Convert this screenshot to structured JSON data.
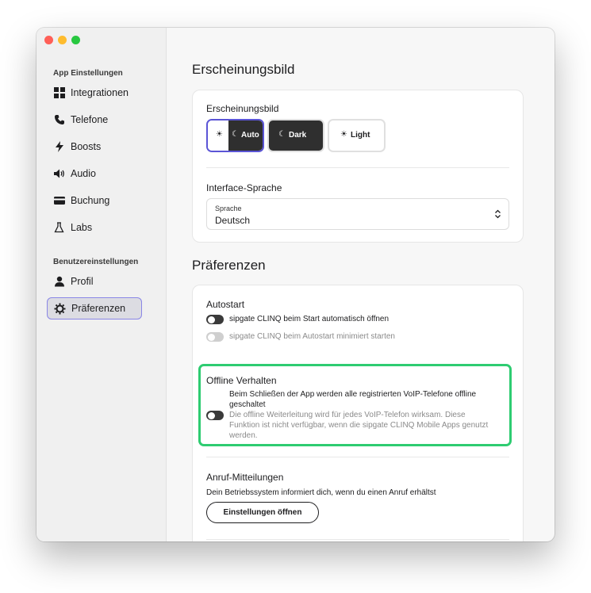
{
  "sidebar": {
    "section_app": "App Einstellungen",
    "section_user": "Benutzereinstellungen",
    "items": [
      {
        "label": "Integrationen",
        "icon": "grid-icon"
      },
      {
        "label": "Telefone",
        "icon": "phone-icon"
      },
      {
        "label": "Boosts",
        "icon": "bolt-icon"
      },
      {
        "label": "Audio",
        "icon": "speaker-icon"
      },
      {
        "label": "Buchung",
        "icon": "credit-card-icon"
      },
      {
        "label": "Labs",
        "icon": "flask-icon"
      },
      {
        "label": "Profil",
        "icon": "user-icon"
      },
      {
        "label": "Präferenzen",
        "icon": "gear-icon",
        "active": true
      }
    ]
  },
  "appearance": {
    "heading": "Erscheinungsbild",
    "label": "Erscheinungsbild",
    "options": [
      {
        "label": "Auto",
        "selected": true
      },
      {
        "label": "Dark"
      },
      {
        "label": "Light"
      }
    ],
    "language_label": "Interface-Sprache",
    "select_caption": "Sprache",
    "select_value": "Deutsch"
  },
  "preferences": {
    "heading": "Präferenzen",
    "autostart_label": "Autostart",
    "autostart_open": "sipgate CLINQ beim Start automatisch öffnen",
    "autostart_minimized": "sipgate CLINQ beim Autostart minimiert starten",
    "offline_label": "Offline Verhalten",
    "offline_line1": "Beim Schließen der App werden alle registrierten VoIP-Telefone offline",
    "offline_line2": "geschaltet",
    "offline_desc1": "Die offline Weiterleitung wird für jedes VoIP-Telefon wirksam. Diese",
    "offline_desc2": "Funktion ist nicht verfügbar, wenn die sipgate CLINQ Mobile Apps genutzt",
    "offline_desc3": "werden.",
    "notify_label": "Anruf-Mitteilungen",
    "notify_desc": "Dein Betriebssystem informiert dich, wenn du einen Anruf erhältst",
    "notify_button": "Einstellungen öffnen"
  },
  "colors": {
    "accent": "#5b55d6",
    "highlight": "#2ecc71",
    "close": "#ff5f57",
    "minimize": "#febc2e",
    "zoom": "#28c840"
  }
}
